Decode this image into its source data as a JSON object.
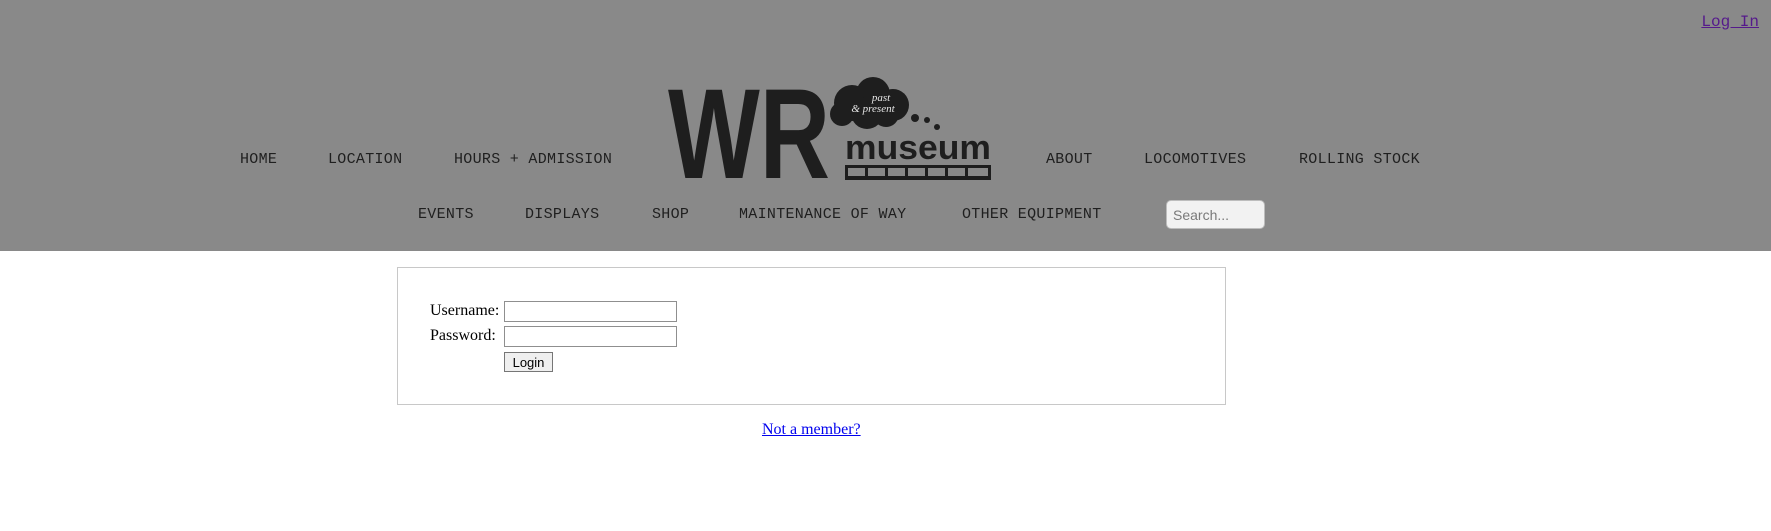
{
  "header": {
    "login_link": "Log In",
    "logo": {
      "big_letters": "WR",
      "cloud_text_1": "past",
      "cloud_text_2": "& present",
      "word": "museum"
    },
    "nav_row1": [
      "HOME",
      "LOCATION",
      "HOURS + ADMISSION",
      "ABOUT",
      "LOCOMOTIVES",
      "ROLLING STOCK"
    ],
    "nav_row2": [
      "EVENTS",
      "DISPLAYS",
      "SHOP",
      "MAINTENANCE OF WAY",
      "OTHER EQUIPMENT"
    ],
    "search_placeholder": "Search..."
  },
  "login_form": {
    "username_label": "Username:",
    "username_value": "",
    "password_label": "Password:",
    "password_value": "",
    "submit_label": "Login"
  },
  "not_member_link": "Not a member?",
  "colors": {
    "header_bg": "#898989",
    "nav_text": "#1f1f1f",
    "logo": "#1e1e1e",
    "visited_link": "#551a8b",
    "link": "#0000ee"
  }
}
